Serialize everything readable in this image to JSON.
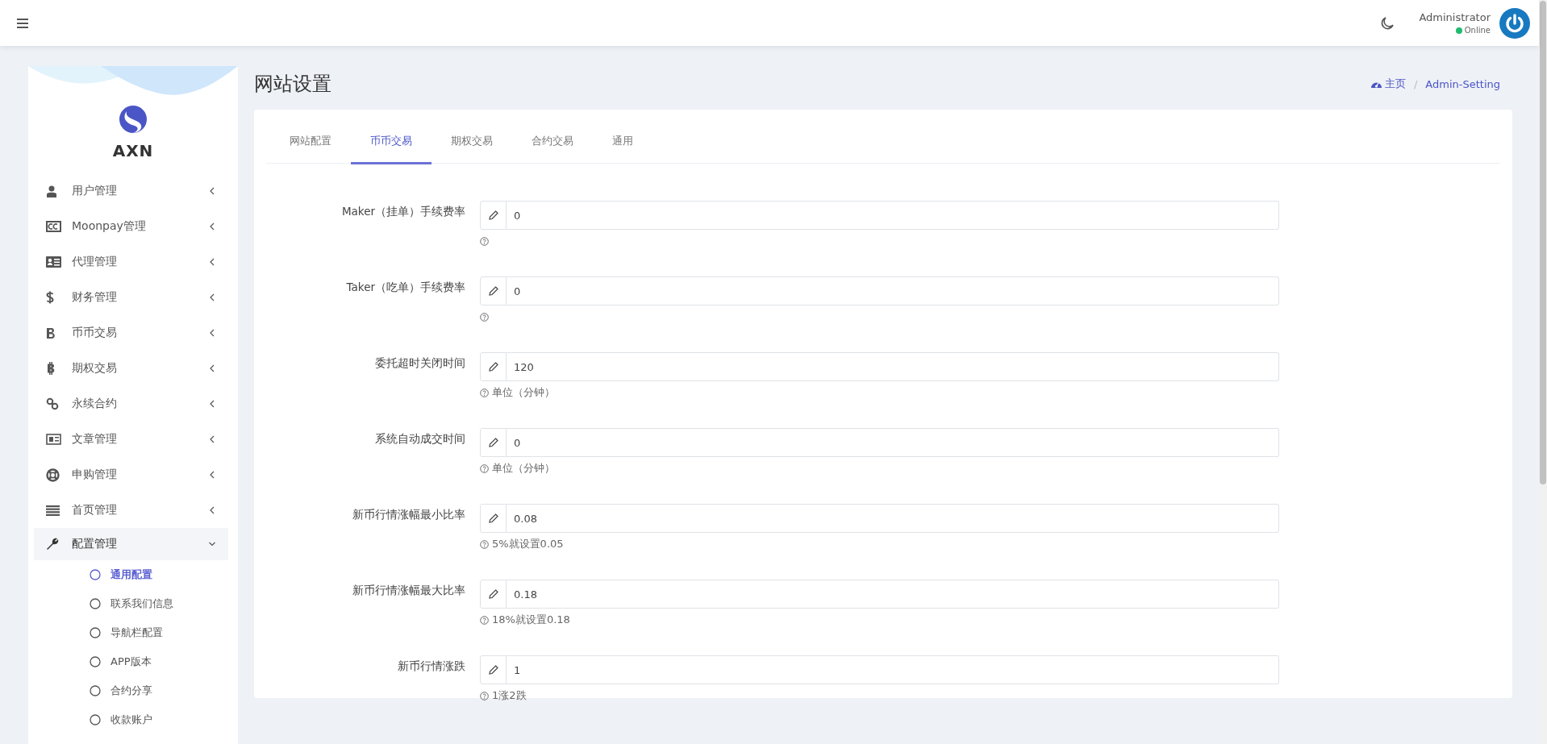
{
  "header": {
    "user_name": "Administrator",
    "status": "Online"
  },
  "sidebar": {
    "brand": "AXN",
    "items": [
      {
        "label": "用户管理",
        "expanded": false
      },
      {
        "label": "Moonpay管理",
        "expanded": false
      },
      {
        "label": "代理管理",
        "expanded": false
      },
      {
        "label": "财务管理",
        "expanded": false
      },
      {
        "label": "币币交易",
        "expanded": false
      },
      {
        "label": "期权交易",
        "expanded": false
      },
      {
        "label": "永续合约",
        "expanded": false
      },
      {
        "label": "文章管理",
        "expanded": false
      },
      {
        "label": "申购管理",
        "expanded": false
      },
      {
        "label": "首页管理",
        "expanded": false
      },
      {
        "label": "配置管理",
        "expanded": true,
        "children": [
          {
            "label": "通用配置",
            "selected": true
          },
          {
            "label": "联系我们信息",
            "selected": false
          },
          {
            "label": "导航栏配置",
            "selected": false
          },
          {
            "label": "APP版本",
            "selected": false
          },
          {
            "label": "合约分享",
            "selected": false
          },
          {
            "label": "收款账户",
            "selected": false
          }
        ]
      }
    ]
  },
  "page": {
    "title": "网站设置",
    "breadcrumb": [
      "主页",
      "Admin-Setting"
    ],
    "breadcrumb_separator": "/"
  },
  "tabs": [
    {
      "label": "网站配置",
      "selected": false
    },
    {
      "label": "币币交易",
      "selected": true
    },
    {
      "label": "期权交易",
      "selected": false
    },
    {
      "label": "合约交易",
      "selected": false
    },
    {
      "label": "通用",
      "selected": false
    }
  ],
  "fields": [
    {
      "label": "Maker（挂单）手续费率",
      "value": "0"
    },
    {
      "label": "Taker（吃单）手续费率",
      "value": "0"
    },
    {
      "label": "委托超时关闭时间",
      "value": "120",
      "hint": "单位（分钟）"
    },
    {
      "label": "系统自动成交时间",
      "value": "0",
      "hint": "单位（分钟）"
    },
    {
      "label": "新币行情涨幅最小比率",
      "value": "0.08",
      "hint": "5%就设置0.05"
    },
    {
      "label": "新币行情涨幅最大比率",
      "value": "0.18",
      "hint": "18%就设置0.18"
    },
    {
      "label": "新币行情涨跌",
      "value": "1",
      "hint": "1涨2跌"
    }
  ]
}
